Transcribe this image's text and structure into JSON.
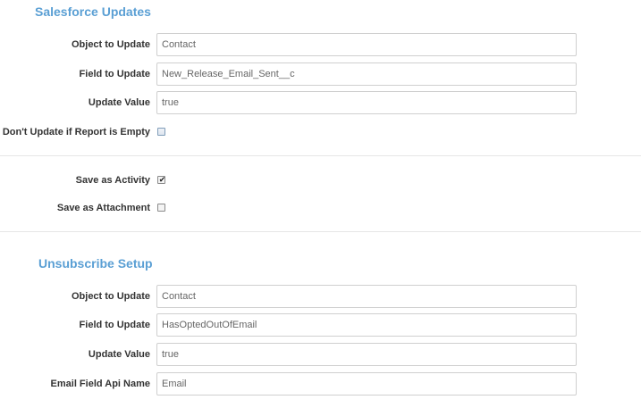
{
  "salesforce_updates": {
    "title": "Salesforce Updates",
    "object_to_update": {
      "label": "Object to Update",
      "value": "Contact"
    },
    "field_to_update": {
      "label": "Field to Update",
      "value": "New_Release_Email_Sent__c"
    },
    "update_value": {
      "label": "Update Value",
      "value": "true"
    },
    "dont_update_if_empty": {
      "label": "Don't Update if Report is Empty",
      "checked": false
    }
  },
  "activity_options": {
    "save_as_activity": {
      "label": "Save as Activity",
      "checked": true
    },
    "save_as_attachment": {
      "label": "Save as Attachment",
      "checked": false
    }
  },
  "unsubscribe_setup": {
    "title": "Unsubscribe Setup",
    "object_to_update": {
      "label": "Object to Update",
      "value": "Contact"
    },
    "field_to_update": {
      "label": "Field to Update",
      "value": "HasOptedOutOfEmail"
    },
    "update_value": {
      "label": "Update Value",
      "value": "true"
    },
    "email_field_api_name": {
      "label": "Email Field Api Name",
      "value": "Email"
    }
  }
}
